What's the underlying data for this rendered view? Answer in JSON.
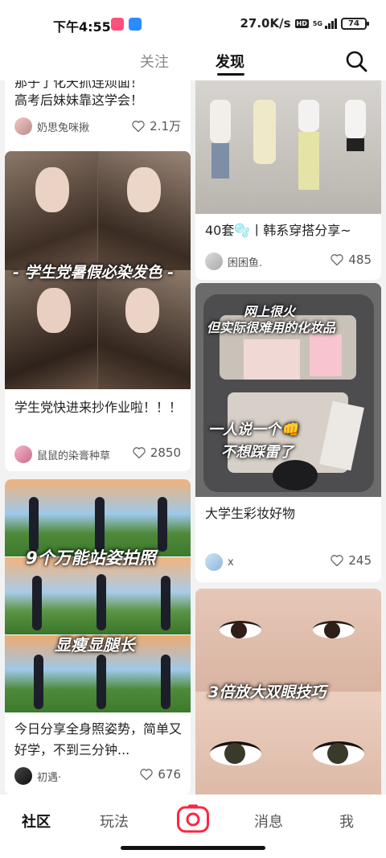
{
  "status_bar": {
    "time": "下午4:55",
    "net_speed": "27.0K/s",
    "hd": "HD",
    "network": "5G",
    "battery": "74"
  },
  "top_nav": {
    "tab_follow": "关注",
    "tab_discover": "发现"
  },
  "feed": {
    "left": [
      {
        "title": "高考后妹妹靠这学会！",
        "title_partial": "那子了化天抓连烦面！",
        "author": "奶思兔咪揪",
        "likes": "2.1万"
      },
      {
        "title": "学生党快进来抄作业啦！！！",
        "author": "鼠鼠的染膏种草",
        "likes": "2850",
        "overlay": "- 学生党暑假必染发色 -"
      },
      {
        "title": "今日分享全身照姿势，简单又好学，不到三分钟...",
        "author": "初遇·",
        "likes": "676",
        "overlay1": "9个万能站姿拍照",
        "overlay2": "显瘦显腿长"
      }
    ],
    "right": [
      {
        "title": "40套🫧丨韩系穿搭分享~",
        "author": "困困鱼.",
        "likes": "485"
      },
      {
        "title": "大学生彩妆好物",
        "author": "x",
        "likes": "245",
        "overlay1": "网上很火",
        "overlay2": "但实际很难用的化妆品",
        "overlay3": "一人说一个👊",
        "overlay4": "不想踩雷了"
      },
      {
        "overlay": "3倍放大双眼技巧"
      }
    ]
  },
  "bottom_nav": {
    "community": "社区",
    "play": "玩法",
    "messages": "消息",
    "me": "我"
  },
  "colors": {
    "accent": "#ff2442",
    "background": "#f2f2f2"
  }
}
